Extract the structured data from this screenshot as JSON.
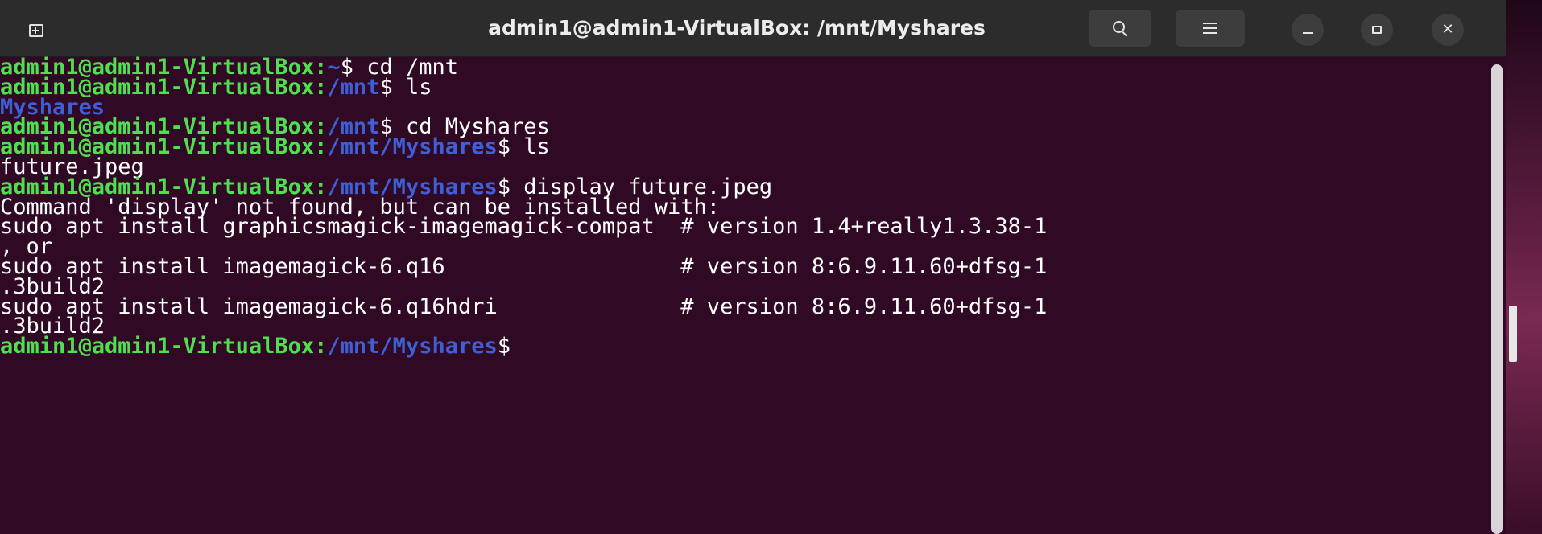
{
  "window": {
    "title": "admin1@admin1-VirtualBox: /mnt/Myshares",
    "icons": {
      "new_tab": "new-tab-icon",
      "search": "search-icon",
      "menu": "hamburger-menu-icon",
      "minimize": "minimize-icon",
      "maximize": "maximize-icon",
      "close": "close-icon"
    },
    "close_glyph": "✕"
  },
  "terminal": {
    "colors": {
      "background": "#300a24",
      "prompt_user": "#4fe04f",
      "prompt_path": "#3f5fd8",
      "text": "#ffffff"
    },
    "lines": [
      {
        "user": "admin1@admin1-VirtualBox",
        "sep": ":",
        "path": "~",
        "sign": "$",
        "cmd": " cd /mnt"
      },
      {
        "user": "admin1@admin1-VirtualBox",
        "sep": ":",
        "path": "/mnt",
        "sign": "$",
        "cmd": " ls"
      },
      {
        "dir": "Myshares"
      },
      {
        "user": "admin1@admin1-VirtualBox",
        "sep": ":",
        "path": "/mnt",
        "sign": "$",
        "cmd": " cd Myshares"
      },
      {
        "user": "admin1@admin1-VirtualBox",
        "sep": ":",
        "path": "/mnt/Myshares",
        "sign": "$",
        "cmd": " ls"
      },
      {
        "text": "future.jpeg"
      },
      {
        "user": "admin1@admin1-VirtualBox",
        "sep": ":",
        "path": "/mnt/Myshares",
        "sign": "$",
        "cmd": " display future.jpeg"
      },
      {
        "text": "Command 'display' not found, but can be installed with:"
      },
      {
        "text": "sudo apt install graphicsmagick-imagemagick-compat  # version 1.4+really1.3.38-1"
      },
      {
        "text": ", or"
      },
      {
        "text": "sudo apt install imagemagick-6.q16                  # version 8:6.9.11.60+dfsg-1"
      },
      {
        "text": ".3build2"
      },
      {
        "text": "sudo apt install imagemagick-6.q16hdri              # version 8:6.9.11.60+dfsg-1"
      },
      {
        "text": ".3build2"
      },
      {
        "user": "admin1@admin1-VirtualBox",
        "sep": ":",
        "path": "/mnt/Myshares",
        "sign": "$",
        "cmd": ""
      }
    ]
  }
}
